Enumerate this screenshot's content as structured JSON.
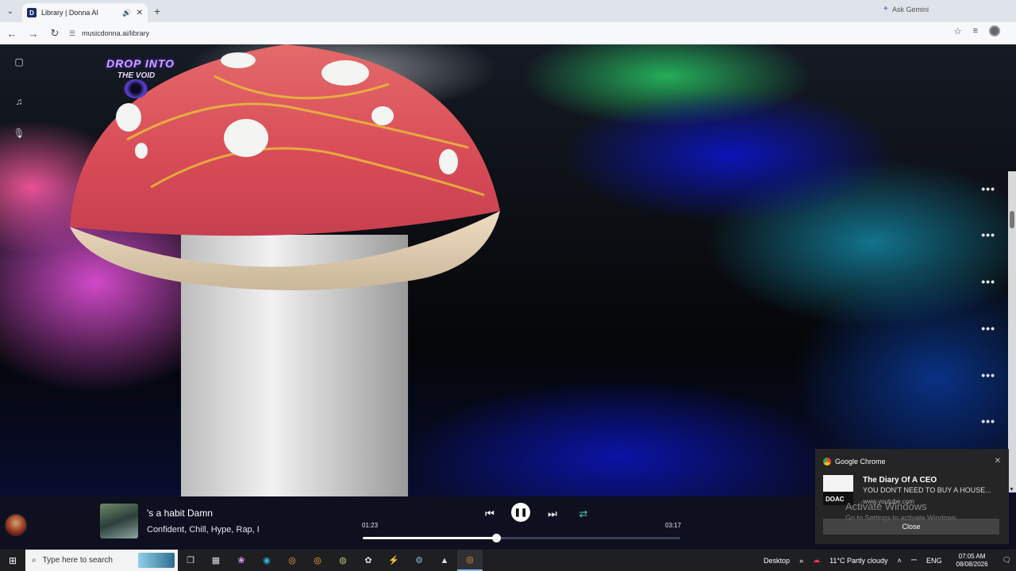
{
  "browser": {
    "tab_title": "Library | Donna AI",
    "tab_favicon": "D",
    "new_tab": "+",
    "ask_gemini": "Ask Gemini",
    "url": "musicdonna.ai/library"
  },
  "promo": {
    "line1": "DROP INTO",
    "line2": "THE VOID"
  },
  "player": {
    "title": "'s a habit Damn",
    "tags": "Confident, Chill, Hype, Rap, I",
    "current_time": "01:23",
    "total_time": "03:17",
    "progress_fraction": 0.42,
    "play_state": "playing"
  },
  "toast": {
    "app": "Google Chrome",
    "title": "The Diary Of A CEO",
    "message": "YOU DON'T NEED TO BUY A HOUSE...",
    "source": "www.youtube.com",
    "thumb_label": "DOAC",
    "close_label": "Close",
    "watermark_title": "Activate Windows",
    "watermark_sub": "Go to Settings to activate Windows."
  },
  "taskbar": {
    "search_placeholder": "Type here to search",
    "desktop_label": "Desktop",
    "weather": "11°C  Partly cloudy",
    "language": "ENG",
    "time": "07:05 AM",
    "date": "08/08/2026"
  },
  "colors": {
    "accent_repeat": "#4ccfb0",
    "player_bg": "#0e1020",
    "progress_track": "#3a3f55"
  }
}
